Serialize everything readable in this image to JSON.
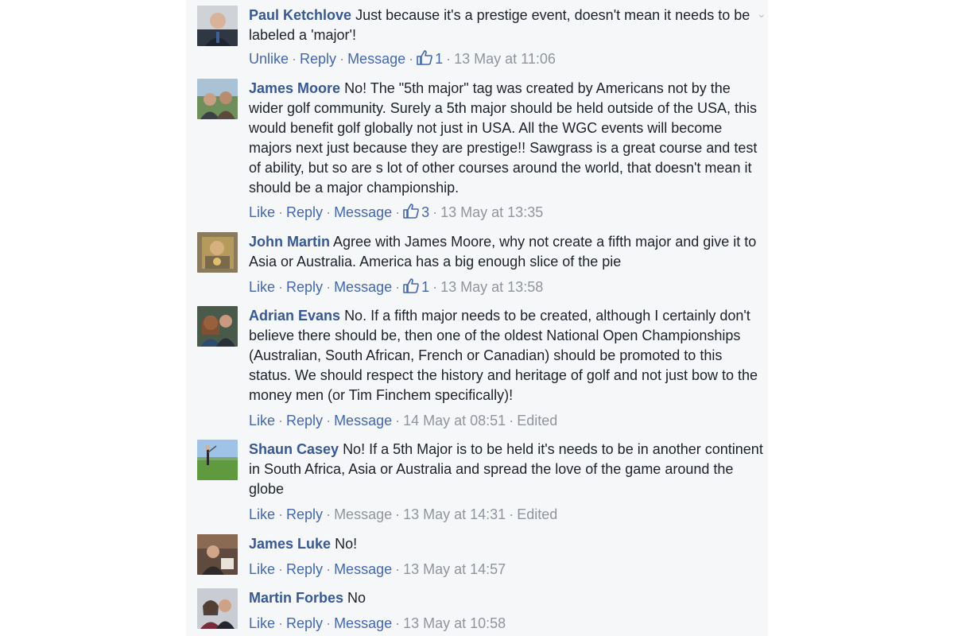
{
  "comments": [
    {
      "author": "Paul Ketchlove",
      "text": "Just because it's a prestige event, doesn't mean it needs to be labeled a 'major'!",
      "like_label": "Unlike",
      "reply_label": "Reply",
      "message_label": "Message",
      "likes": "1",
      "timestamp": "13 May at 11:06",
      "edited": ""
    },
    {
      "author": "James Moore",
      "text": "No! The \"5th major\" tag was created by Americans not by the wider golf community. Surely a 5th major should be held outside of the USA, this would benefit golf globally not just in USA. All the WGC events will become majors next just because they are prestige!! Sawgrass is a great course and test of ability, but so are s lot of other courses around the world, that doesn't mean it should be a major championship.",
      "like_label": "Like",
      "reply_label": "Reply",
      "message_label": "Message",
      "likes": "3",
      "timestamp": "13 May at 13:35",
      "edited": ""
    },
    {
      "author": "John Martin",
      "text": "Agree with James Moore, why not create a fifth major and give it to Asia or Australia. America has a big enough slice of the pie",
      "like_label": "Like",
      "reply_label": "Reply",
      "message_label": "Message",
      "likes": "1",
      "timestamp": "13 May at 13:58",
      "edited": ""
    },
    {
      "author": "Adrian Evans",
      "text": "No. If a fifth major needs to be created, although I certainly don't believe there should be, then one of the oldest National Open Championships (Australian, South African, French or Canadian) should be promoted to this status. We should respect the history and heritage of golf and not just bow to the money men (or Tim Finchem specifically)!",
      "like_label": "Like",
      "reply_label": "Reply",
      "message_label": "Message",
      "likes": "",
      "timestamp": "14 May at 08:51",
      "edited": "Edited"
    },
    {
      "author": "Shaun Casey",
      "text": "No! If a 5th Major is to be held it's needs to be in another continent in South Africa, Asia or Australia and spread the love of the game around the globe",
      "like_label": "Like",
      "reply_label": "Reply",
      "message_label": "Message",
      "likes": "",
      "timestamp": "13 May at 14:31",
      "edited": "Edited"
    },
    {
      "author": "James Luke",
      "text": "No!",
      "like_label": "Like",
      "reply_label": "Reply",
      "message_label": "Message",
      "likes": "",
      "timestamp": "13 May at 14:57",
      "edited": ""
    },
    {
      "author": "Martin Forbes",
      "text": "No",
      "like_label": "Like",
      "reply_label": "Reply",
      "message_label": "Message",
      "likes": "",
      "timestamp": "13 May at 10:58",
      "edited": ""
    }
  ],
  "colors": {
    "author": "#365899",
    "action_link": "#4267b2",
    "meta_grey": "#90949c",
    "panel_bg": "#f6f7f9"
  },
  "icons": {
    "like": "thumbs-up-icon",
    "options": "chevron-down-icon"
  }
}
